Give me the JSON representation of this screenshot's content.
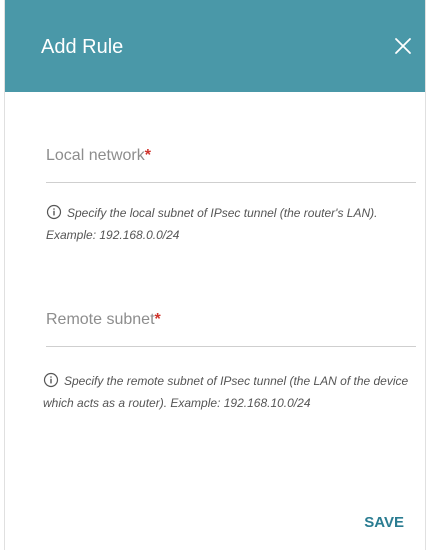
{
  "dialog": {
    "title": "Add Rule",
    "close_icon": "close-icon",
    "accent_color": "#4a98a8"
  },
  "fields": [
    {
      "label": "Local network",
      "required_mark": "*",
      "hint": "Specify the local subnet of IPsec tunnel (the router's LAN). Example: 192.168.0.0/24"
    },
    {
      "label": "Remote subnet",
      "required_mark": "*",
      "hint": "Specify the remote subnet of IPsec tunnel (the LAN of the device which acts as a router). Example: 192.168.10.0/24"
    }
  ],
  "actions": {
    "save_label": "SAVE"
  }
}
